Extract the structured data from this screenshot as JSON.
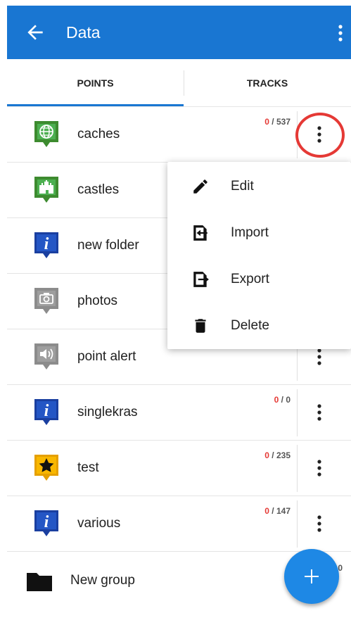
{
  "appbar": {
    "title": "Data"
  },
  "tabs": [
    {
      "label": "POINTS"
    },
    {
      "label": "TRACKS"
    }
  ],
  "rows": [
    {
      "label": "caches",
      "count_red": "0",
      "count_rest": " / 537",
      "icon": "globe-icon"
    },
    {
      "label": "castles",
      "count_red": "",
      "count_rest": "",
      "icon": "castle-icon"
    },
    {
      "label": "new folder",
      "count_red": "",
      "count_rest": "",
      "icon": "info-icon"
    },
    {
      "label": "photos",
      "count_red": "",
      "count_rest": "",
      "icon": "camera-icon"
    },
    {
      "label": "point alert",
      "count_red": "",
      "count_rest": "",
      "icon": "speaker-icon"
    },
    {
      "label": "singlekras",
      "count_red": "0",
      "count_rest": " / 0",
      "icon": "info-icon"
    },
    {
      "label": "test",
      "count_red": "0",
      "count_rest": " / 235",
      "icon": "star-icon"
    },
    {
      "label": "various",
      "count_red": "0",
      "count_rest": " / 147",
      "icon": "info-icon"
    }
  ],
  "group": {
    "label": "New group",
    "count": "0"
  },
  "menu": {
    "items": [
      {
        "label": "Edit"
      },
      {
        "label": "Import"
      },
      {
        "label": "Export"
      },
      {
        "label": "Delete"
      }
    ]
  },
  "colors": {
    "primary": "#1976d2",
    "fab": "#1e88e5",
    "accent_red": "#e53935"
  }
}
